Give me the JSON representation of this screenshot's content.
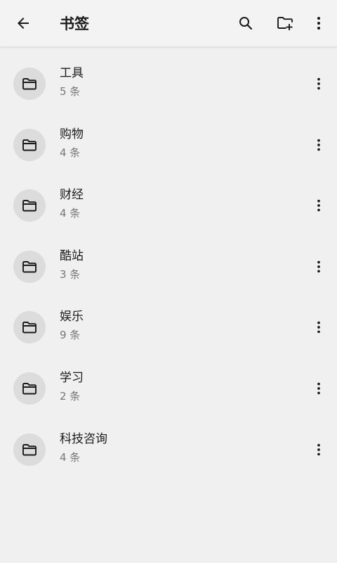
{
  "header": {
    "title": "书签",
    "icons": {
      "back": "arrow-back-icon",
      "search": "search-icon",
      "new_folder": "create-new-folder-icon",
      "more": "more-vert-icon"
    }
  },
  "folders": [
    {
      "name": "工具",
      "count": "5 条"
    },
    {
      "name": "购物",
      "count": "4 条"
    },
    {
      "name": "财经",
      "count": "4 条"
    },
    {
      "name": "酷站",
      "count": "3 条"
    },
    {
      "name": "娱乐",
      "count": "9 条"
    },
    {
      "name": "学习",
      "count": "2 条"
    },
    {
      "name": "科技咨询",
      "count": "4 条"
    }
  ],
  "colors": {
    "background": "#f0f0f0",
    "avatar_bg": "#dcdcdc",
    "primary_text": "#1a1a1a",
    "secondary_text": "#777777"
  }
}
